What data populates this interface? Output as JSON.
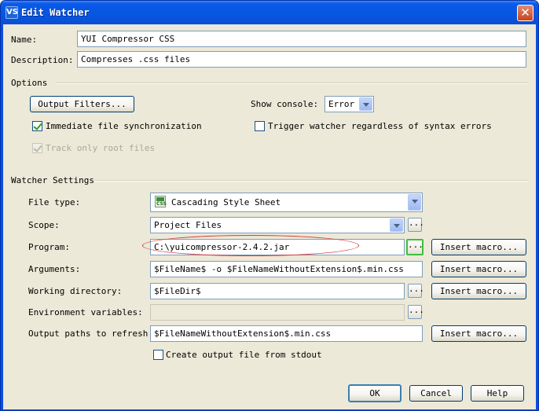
{
  "window": {
    "title": "Edit Watcher",
    "app_icon": "VS",
    "close_glyph": "✕"
  },
  "fields": {
    "name_label": "Name:",
    "name_value": "YUI Compressor CSS",
    "description_label": "Description:",
    "description_value": "Compresses .css files"
  },
  "options": {
    "group_label": "Options",
    "output_filters_button": "Output Filters...",
    "show_console_label": "Show console:",
    "show_console_value": "Error",
    "immediate_sync_label": "Immediate file synchronization",
    "immediate_sync_checked": true,
    "trigger_watcher_label": "Trigger watcher regardless of syntax errors",
    "trigger_watcher_checked": false,
    "track_root_label": "Track only root files",
    "track_root_checked": true
  },
  "watcher_settings": {
    "group_label": "Watcher Settings",
    "file_type_label": "File type:",
    "file_type_value": "Cascading Style Sheet",
    "file_type_icon": "css-file-icon",
    "scope_label": "Scope:",
    "scope_value": "Project Files",
    "program_label": "Program:",
    "program_value": "C:\\yuicompressor-2.4.2.jar",
    "arguments_label": "Arguments:",
    "arguments_value": "$FileName$ -o $FileNameWithoutExtension$.min.css",
    "working_dir_label": "Working directory:",
    "working_dir_value": "$FileDir$",
    "env_vars_label": "Environment variables:",
    "env_vars_value": "",
    "output_paths_label": "Output paths to refresh:",
    "output_paths_value": "$FileNameWithoutExtension$.min.css",
    "create_output_label": "Create output file from stdout",
    "create_output_checked": false,
    "insert_macro_label": "Insert macro...",
    "browse_label": "..."
  },
  "footer": {
    "ok_label": "OK",
    "cancel_label": "Cancel",
    "help_label": "Help"
  },
  "colors": {
    "titlebar_blue": "#0a5ae8",
    "dialog_bg": "#ece9d8",
    "annotation_red": "#d63a3a",
    "focus_green": "#3fbf3f"
  }
}
